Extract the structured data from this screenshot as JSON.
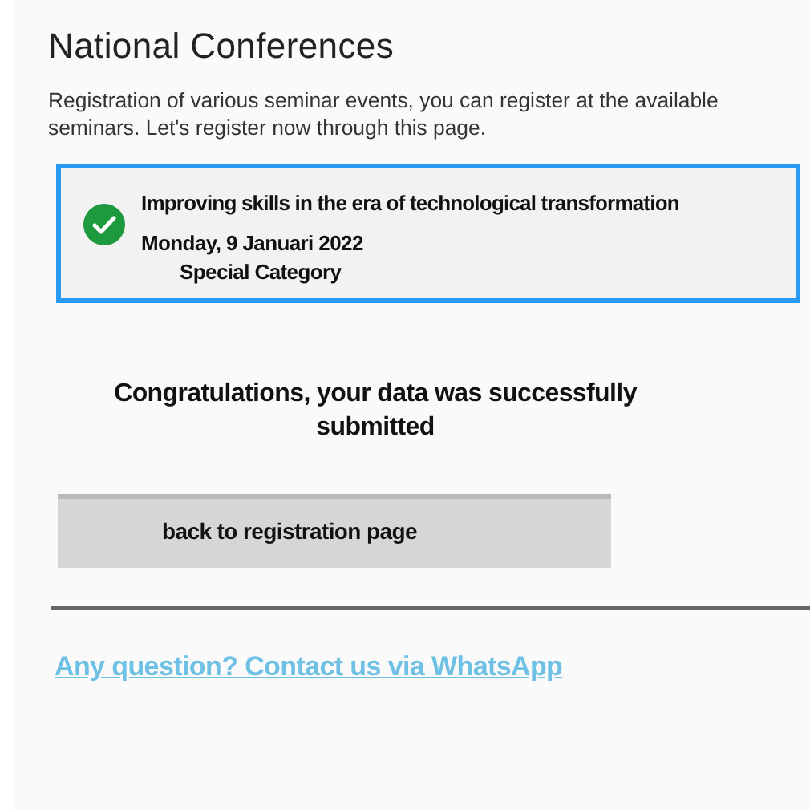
{
  "title": "National Conferences",
  "description": "Registration of various seminar events, you can register at the available seminars. Let's register now through this page.",
  "seminar": {
    "registered": true,
    "title": "Improving skills in the era of technological transformation",
    "date": "Monday, 9 Januari 2022",
    "category": "Special Category"
  },
  "message": "Congratulations, your data was successfully submitted",
  "back_button": "back to registration page",
  "contact_link": "Any question? Contact us via WhatsApp"
}
